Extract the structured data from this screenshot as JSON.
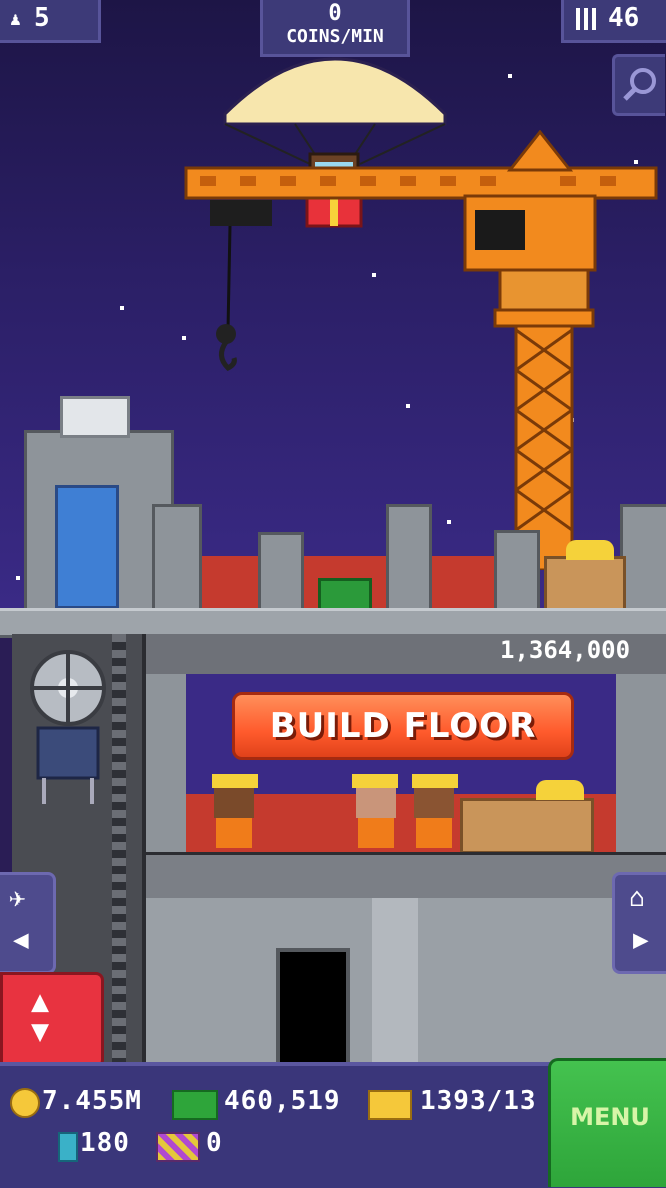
{
  "hud": {
    "population": "5",
    "coins_per_min_value": "0",
    "coins_per_min_label": "COINS/MIN",
    "floors": "46"
  },
  "build": {
    "cost": "1,364,000",
    "button_label": "BUILD FLOOR"
  },
  "currency": {
    "coins": "7.455M",
    "bux": "460,519",
    "tickets": "1393/13",
    "cards": "180",
    "gold_tickets": "0"
  },
  "menu_label": "MENU",
  "colors": {
    "crane_orange": "#f28a1e",
    "build_button": "#ff6b3d",
    "menu_green": "#2ea53a",
    "elevator_red": "#e83340"
  }
}
